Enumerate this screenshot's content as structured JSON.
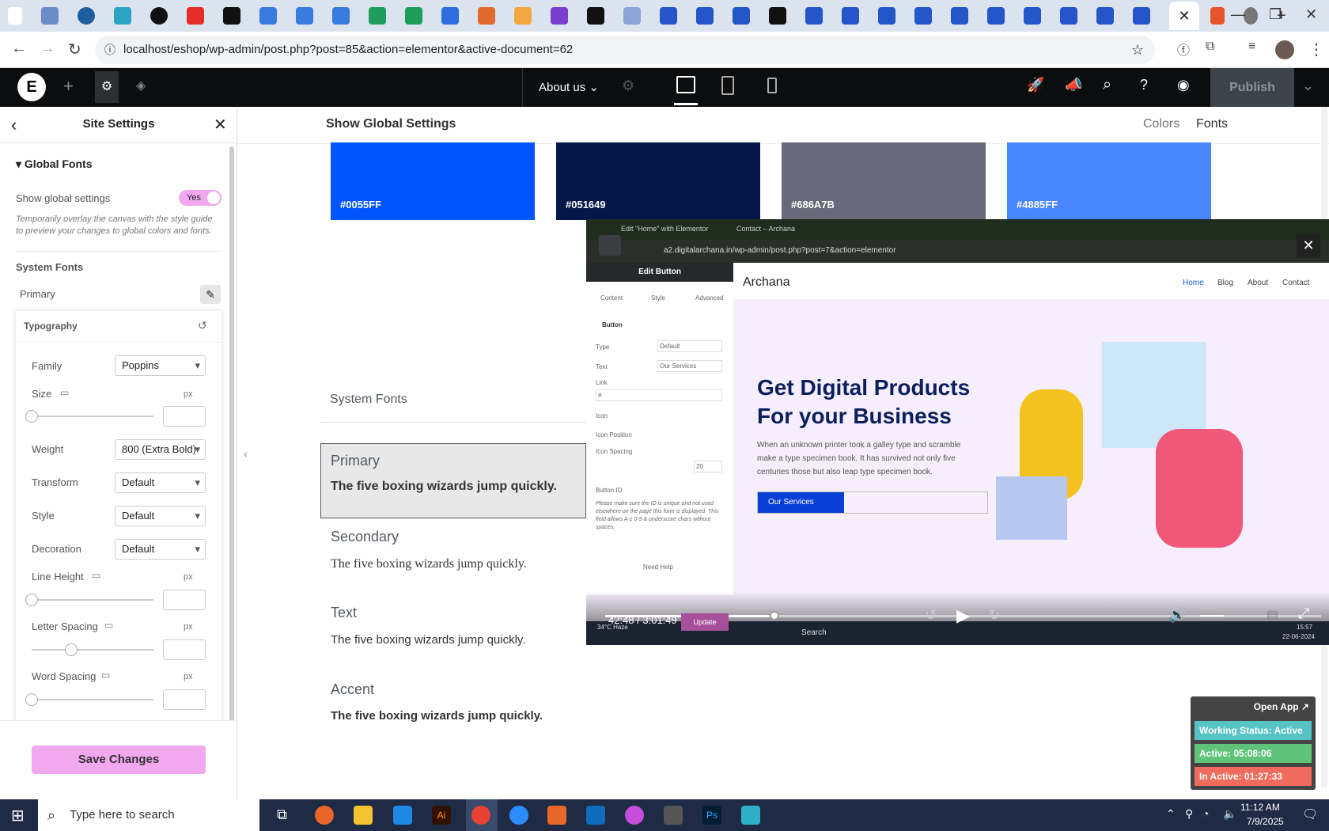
{
  "browser": {
    "url": "localhost/eshop/wp-admin/post.php?post=85&action=elementor&active-document=62",
    "active_tab_close": "✕",
    "new_tab": "+"
  },
  "topbar": {
    "page_name": "About us",
    "publish_label": "Publish"
  },
  "panel": {
    "title": "Site Settings",
    "section": "Global Fonts",
    "show_global_label": "Show global settings",
    "toggle_value": "Yes",
    "help_text": "Temporarily overlay the canvas with the style guide to preview your changes to global colors and fonts.",
    "system_fonts_heading": "System Fonts",
    "primary_label": "Primary",
    "typography_title": "Typography",
    "fields": {
      "family_label": "Family",
      "family_value": "Poppins",
      "size_label": "Size",
      "weight_label": "Weight",
      "weight_value": "800 (Extra Bold)",
      "transform_label": "Transform",
      "transform_value": "Default",
      "style_label": "Style",
      "style_value": "Default",
      "decoration_label": "Decoration",
      "decoration_value": "Default",
      "line_height_label": "Line Height",
      "letter_spacing_label": "Letter Spacing",
      "word_spacing_label": "Word Spacing",
      "unit": "px"
    },
    "save_label": "Save Changes"
  },
  "canvas": {
    "heading": "Show Global Settings",
    "tab_colors": "Colors",
    "tab_fonts": "Fonts",
    "swatches": [
      {
        "hex": "#0055FF",
        "color": "#0055FF"
      },
      {
        "hex": "#051649",
        "color": "#051649"
      },
      {
        "hex": "#686A7B",
        "color": "#686A7B"
      },
      {
        "hex": "#4885FF",
        "color": "#4885FF"
      }
    ],
    "system_fonts_heading": "System Fonts",
    "fonts": [
      {
        "name": "Primary",
        "sample": "The five boxing wizards jump quickly."
      },
      {
        "name": "Secondary",
        "sample": "The five boxing wizards jump quickly."
      },
      {
        "name": "Text",
        "sample": "The five boxing wizards jump quickly."
      },
      {
        "name": "Accent",
        "sample": "The five boxing wizards jump quickly."
      }
    ]
  },
  "video": {
    "tab1": "Edit \"Home\" with Elementor",
    "tab2": "Contact – Archana",
    "url": "a2.digitalarchana.in/wp-admin/post.php?post=7&action=elementor",
    "panel_title": "Edit Button",
    "panel_tabs": [
      "Content",
      "Style",
      "Advanced"
    ],
    "section": "Button",
    "rows": [
      "Type",
      "Text",
      "Link",
      "Icon",
      "Icon Position",
      "Icon Spacing",
      "Button ID"
    ],
    "type_value": "Default",
    "text_value": "Our Services",
    "link_value": "#",
    "spacing_value": "20",
    "note": "Please make sure the ID is unique and not used elsewhere on the page this form is displayed. This field allows A-z 0-9 & underscore chars without spaces.",
    "need_help": "Need Help",
    "update_label": "Update",
    "site_logo": "Archana",
    "site_nav": [
      "Home",
      "Blog",
      "About",
      "Contact"
    ],
    "hero_title_1": "Get Digital Products",
    "hero_title_2": "For your Business",
    "hero_text": "When an unknown printer took a galley type and scramble make a type specimen book. It has survived not only five centuries those but also leap type specimen book.",
    "hero_button": "Our Services",
    "time": "42:48 / 3:01:49",
    "progress": 0.236,
    "taskbar_search": "Search",
    "taskbar_time": "15:57",
    "taskbar_date": "22-06-2024",
    "weather": "34°C Haze"
  },
  "status_widget": {
    "open_app": "Open App ↗",
    "working": "Working Status: Active",
    "active": "Active: 05:08:06",
    "inactive": "In Active: 01:27:33"
  },
  "taskbar": {
    "search_placeholder": "Type here to search",
    "time": "11:12 AM",
    "date": "7/9/2025"
  }
}
